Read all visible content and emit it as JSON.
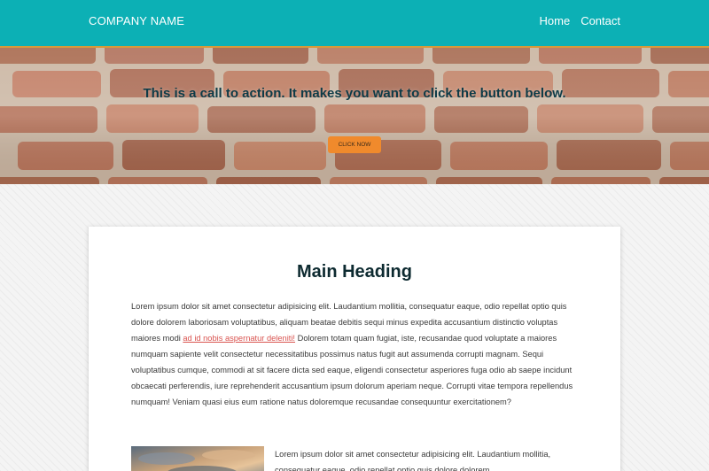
{
  "navbar": {
    "brand": "COMPANY NAME",
    "links": [
      "Home",
      "Contact"
    ]
  },
  "hero": {
    "title": "This is a call to action. It makes you want to click the button below.",
    "button_label": "CLICK NOW"
  },
  "content": {
    "heading": "Main Heading",
    "paragraph_before_link": "Lorem ipsum dolor sit amet consectetur adipisicing elit. Laudantium mollitia, consequatur eaque, odio repellat optio quis dolore dolorem laboriosam voluptatibus, aliquam beatae debitis sequi minus expedita accusantium distinctio voluptas maiores modi ",
    "link_text": "ad id nobis aspernatur deleniti!",
    "paragraph_after_link": " Dolorem totam quam fugiat, iste, recusandae quod voluptate a maiores numquam sapiente velit consectetur necessitatibus possimus natus fugit aut assumenda corrupti magnam. Sequi voluptatibus cumque, commodi at sit facere dicta sed eaque, eligendi consectetur asperiores fuga odio ab saepe incidunt obcaecati perferendis, iure reprehenderit accusantium ipsum dolorum aperiam neque. Corrupti vitae tempora repellendus numquam! Veniam quasi eius eum ratione natus doloremque recusandae consequuntur exercitationem?",
    "paragraph2": "Lorem ipsum dolor sit amet consectetur adipisicing elit. Laudantium mollitia, consequatur eaque, odio repellat optio quis dolore dolorem"
  },
  "colors": {
    "navbar": "#0cb0b5",
    "accent_border": "#d79a3a",
    "cta_button": "#f08a2c",
    "hero_title": "#0d3b47",
    "link": "#d9534f"
  }
}
